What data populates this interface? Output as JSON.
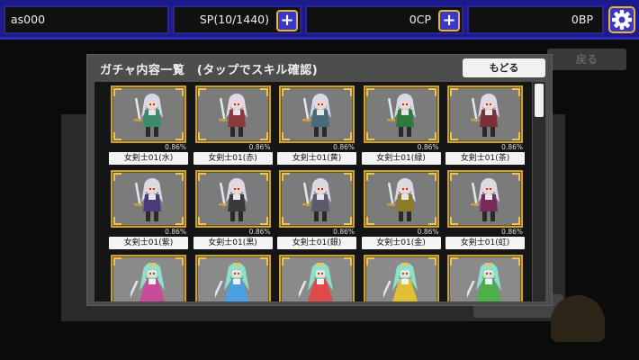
{
  "topbar": {
    "player_name": "as000",
    "sp": "SP(10/1440)",
    "cp": "0CP",
    "bp": "0BP",
    "plus": "+"
  },
  "background": {
    "back_button": "戻る"
  },
  "modal": {
    "title": "ガチャ内容一覧　(タップでスキル確認)",
    "close_label": "もどる",
    "items": [
      {
        "name": "女剣士01(水)",
        "rate": "0.86%",
        "tint": "#3d8a6c",
        "hair": "#d8d8e8",
        "type": "swordswoman"
      },
      {
        "name": "女剣士01(赤)",
        "rate": "0.86%",
        "tint": "#8a3a3a",
        "hair": "#e0d8e8",
        "type": "swordswoman"
      },
      {
        "name": "女剣士01(黄)",
        "rate": "0.86%",
        "tint": "#4a6a7a",
        "hair": "#d8d8e8",
        "type": "swordswoman"
      },
      {
        "name": "女剣士01(緑)",
        "rate": "0.86%",
        "tint": "#2f7a3a",
        "hair": "#d8d8e8",
        "type": "swordswoman"
      },
      {
        "name": "女剣士01(茶)",
        "rate": "0.86%",
        "tint": "#7a3038",
        "hair": "#e0d8e8",
        "type": "swordswoman"
      },
      {
        "name": "女剣士01(紫)",
        "rate": "0.86%",
        "tint": "#4a3a7a",
        "hair": "#d8d8e8",
        "type": "swordswoman"
      },
      {
        "name": "女剣士01(黒)",
        "rate": "0.86%",
        "tint": "#3a3a3a",
        "hair": "#e0d8e8",
        "type": "swordswoman"
      },
      {
        "name": "女剣士01(銀)",
        "rate": "0.86%",
        "tint": "#5a5a68",
        "hair": "#d8d8e8",
        "type": "swordswoman"
      },
      {
        "name": "女剣士01(金)",
        "rate": "0.86%",
        "tint": "#8a7a2a",
        "hair": "#d8d8e8",
        "type": "swordswoman"
      },
      {
        "name": "女剣士01(虹)",
        "rate": "0.86%",
        "tint": "#7a2a5a",
        "hair": "#e0d8e8",
        "type": "swordswoman"
      },
      {
        "name": "",
        "rate": "",
        "tint": "#c84a9a",
        "hair": "#8fe0c8",
        "type": "princess"
      },
      {
        "name": "",
        "rate": "",
        "tint": "#4aa0e0",
        "hair": "#8fe0c8",
        "type": "princess"
      },
      {
        "name": "",
        "rate": "",
        "tint": "#e04a4a",
        "hair": "#8fe0c8",
        "type": "princess"
      },
      {
        "name": "",
        "rate": "",
        "tint": "#e0c030",
        "hair": "#8fe0c8",
        "type": "princess"
      },
      {
        "name": "",
        "rate": "",
        "tint": "#4ab04a",
        "hair": "#8fe0c8",
        "type": "princess"
      }
    ]
  }
}
